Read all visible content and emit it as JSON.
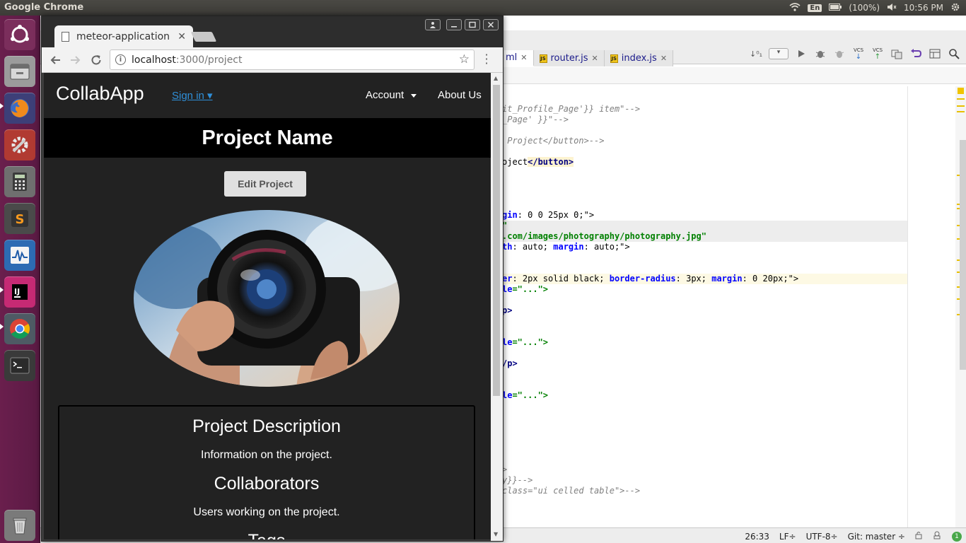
{
  "top_panel": {
    "app_title": "Google Chrome",
    "keyboard": "En",
    "battery": "(100%)",
    "time": "10:56 PM"
  },
  "launcher": {
    "items": [
      "ubuntu-dash",
      "files",
      "firefox",
      "system-settings",
      "calculator",
      "sublime-text",
      "system-monitor",
      "intellij-idea",
      "google-chrome",
      "terminal"
    ],
    "trash": "trash"
  },
  "ide": {
    "tabs": [
      {
        "label": "ml",
        "active": true
      },
      {
        "label": "router.js",
        "active": false
      },
      {
        "label": "index.js",
        "active": false
      }
    ],
    "toolbar_vcs1": "VCS",
    "toolbar_vcs2": "VCS",
    "code": {
      "l1": "it_Profile_Page'}} item\"-->",
      "l2": "_Page' }}\"-->",
      "l3": " Project</button>-->",
      "l4a": "oject",
      "l4b": "</button>",
      "l5a": "gin",
      "l5b": ": 0 0 25px 0;\">",
      "l6": "\"",
      "l7": ".com/images/photography/photography.jpg\"",
      "l8a": "th",
      "l8b": ": auto; ",
      "l8c": "margin",
      "l8d": ": auto;\">",
      "l9a": "er",
      "l9b": ": 2px solid black; ",
      "l9c": "border-radius",
      "l9d": ": 3px; ",
      "l9e": "margin",
      "l9f": ": 0 20px;\">",
      "l10a": "le",
      "l10b": "=\"...\">",
      "l11": "p>",
      "l12a": "le",
      "l12b": "=\"...\">",
      "l13": "/p>",
      "l14a": "le",
      "l14b": "=\"...\">",
      "l15": ">",
      "l16": "y}}-->",
      "l17": "class=\"ui celled table\">-->"
    },
    "status": {
      "position": "26:33",
      "line_sep": "LF÷",
      "encoding": "UTF-8÷",
      "git": "Git: master ÷",
      "badge": "1"
    }
  },
  "chrome": {
    "tab_title": "meteor-application",
    "url_host": "localhost",
    "url_path": ":3000/project"
  },
  "page": {
    "brand": "CollabApp",
    "sign_in": "Sign in ▾",
    "account": "Account",
    "about": "About Us",
    "project_name": "Project Name",
    "edit_button": "Edit Project",
    "description_heading": "Project Description",
    "description_text": "Information on the project.",
    "collaborators_heading": "Collaborators",
    "collaborators_text": "Users working on the project.",
    "tags_heading": "Tags"
  }
}
